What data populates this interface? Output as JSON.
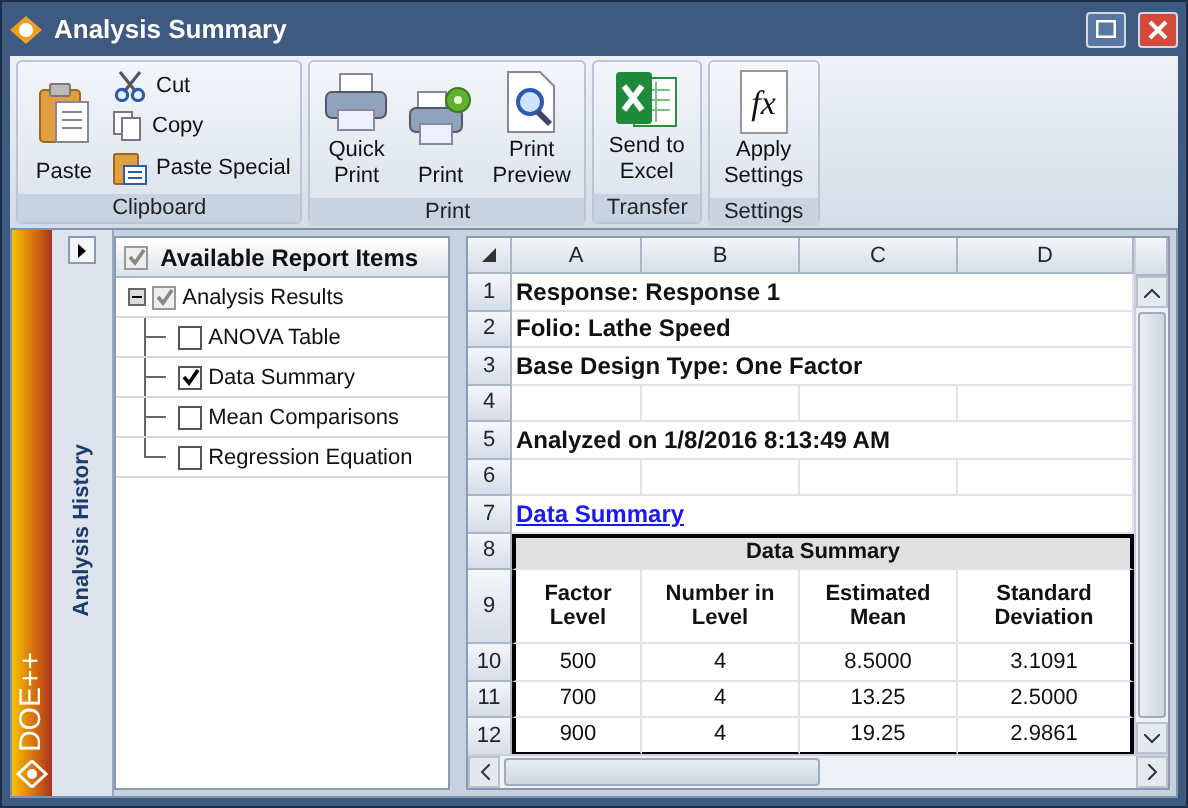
{
  "window": {
    "title": "Analysis Summary"
  },
  "ribbon": {
    "groups": [
      {
        "label": "Clipboard",
        "buttons": [
          {
            "lines": [
              "Paste"
            ],
            "kind": "paste"
          }
        ],
        "small_buttons": [
          {
            "label": "Cut",
            "kind": "cut"
          },
          {
            "label": "Copy",
            "kind": "copy"
          },
          {
            "label": "Paste Special",
            "kind": "paste-special"
          }
        ]
      },
      {
        "label": "Print",
        "buttons": [
          {
            "lines": [
              "Quick",
              "Print"
            ],
            "kind": "quick-print"
          },
          {
            "lines": [
              "Print"
            ],
            "kind": "print"
          },
          {
            "lines": [
              "Print",
              "Preview"
            ],
            "kind": "print-preview"
          }
        ]
      },
      {
        "label": "Transfer",
        "buttons": [
          {
            "lines": [
              "Send to",
              "Excel"
            ],
            "kind": "excel"
          }
        ]
      },
      {
        "label": "Settings",
        "buttons": [
          {
            "lines": [
              "Apply",
              "Settings"
            ],
            "kind": "function",
            "glyph": "fx"
          }
        ]
      }
    ]
  },
  "side_strip": {
    "logo": "DOE++"
  },
  "history_panel": {
    "title": "Analysis History",
    "expanded": false
  },
  "tree": {
    "header": {
      "label": "Available Report Items",
      "checked": true
    },
    "items": [
      {
        "label": "Analysis Results",
        "checked": true,
        "expanded": true,
        "children": [
          {
            "label": "ANOVA Table",
            "checked": false
          },
          {
            "label": "Data Summary",
            "checked": true
          },
          {
            "label": "Mean Comparisons",
            "checked": false
          },
          {
            "label": "Regression Equation",
            "checked": false
          }
        ]
      }
    ]
  },
  "sheet": {
    "columns": [
      "A",
      "B",
      "C",
      "D"
    ],
    "rows": [
      {
        "number": "1",
        "kind": "heading",
        "text": "Response: Response 1"
      },
      {
        "number": "2",
        "kind": "heading",
        "text": "Folio: Lathe Speed"
      },
      {
        "number": "3",
        "kind": "heading",
        "text": "Base Design Type: One Factor"
      },
      {
        "number": "4",
        "kind": "blank"
      },
      {
        "number": "5",
        "kind": "heading",
        "text": "Analyzed on 1/8/2016 8:13:49 AM"
      },
      {
        "number": "6",
        "kind": "blank"
      },
      {
        "number": "7",
        "kind": "link",
        "text": "Data Summary"
      },
      {
        "number": "8",
        "kind": "table-title",
        "text": "Data Summary"
      },
      {
        "number": "9",
        "kind": "table-header",
        "cells": [
          "Factor Level",
          "Number in Level",
          "Estimated Mean",
          "Standard Deviation"
        ]
      },
      {
        "number": "10",
        "kind": "table-row",
        "cells": [
          "500",
          "4",
          "8.5000",
          "3.1091"
        ]
      },
      {
        "number": "11",
        "kind": "table-row",
        "cells": [
          "700",
          "4",
          "13.25",
          "2.5000"
        ]
      },
      {
        "number": "12",
        "kind": "table-row",
        "cells": [
          "900",
          "4",
          "19.25",
          "2.9861"
        ]
      }
    ]
  }
}
